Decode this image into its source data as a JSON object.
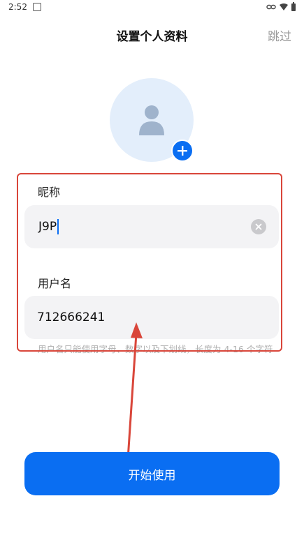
{
  "status_bar": {
    "time": "2:52",
    "left_icon": "shield-icon",
    "right_icons": [
      "link-icon",
      "wifi-icon",
      "battery-icon"
    ]
  },
  "header": {
    "title": "设置个人资料",
    "skip_label": "跳过"
  },
  "avatar": {
    "icon": "person-icon",
    "add_icon": "plus-icon"
  },
  "form": {
    "nickname": {
      "label": "昵称",
      "value": "J9P",
      "clear_icon": "clear-icon"
    },
    "username": {
      "label": "用户名",
      "value": "712666241",
      "hint": "用户名只能使用字母、数字以及下划线，长度为 4-16 个字符"
    }
  },
  "start_button": {
    "label": "开始使用"
  },
  "colors": {
    "primary": "#0a6ef2",
    "avatar_bg": "#e3eefb",
    "input_bg": "#f3f3f5",
    "annotation": "#d9463a",
    "muted_text": "#9a9a9a"
  }
}
